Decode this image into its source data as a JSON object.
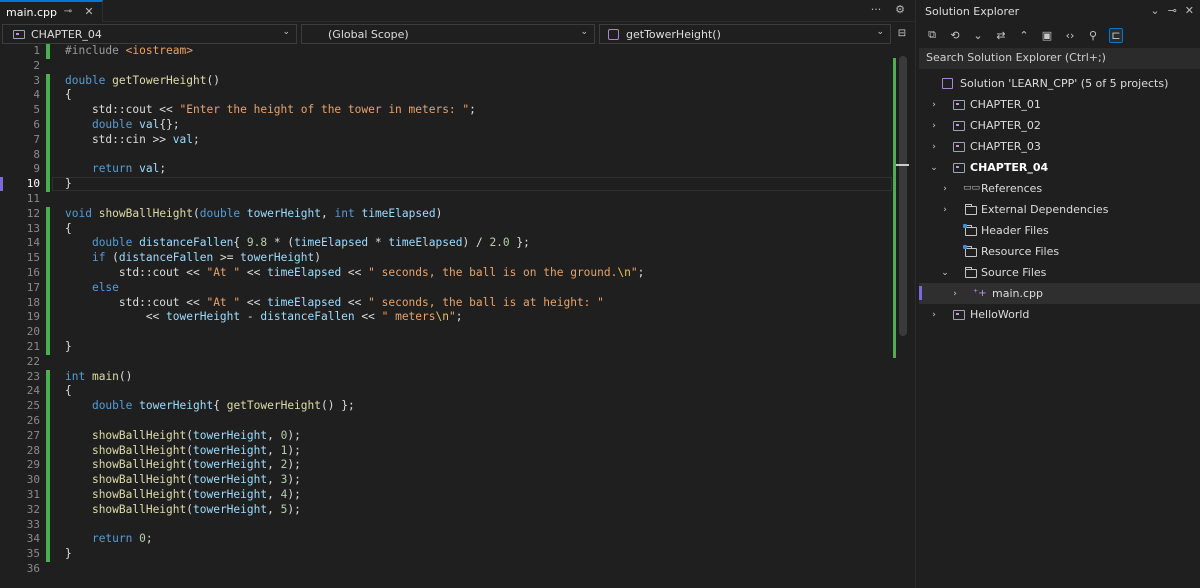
{
  "editor": {
    "tab": {
      "label": "main.cpp"
    },
    "tab_tools": {
      "overflow": "···",
      "settings": "⚙"
    },
    "project_dropdown": "CHAPTER_04",
    "scope_dropdown": "(Global Scope)",
    "member_dropdown": "getTowerHeight()",
    "current_line": 10,
    "line_numbers": [
      "1",
      "2",
      "3",
      "4",
      "5",
      "6",
      "7",
      "8",
      "9",
      "10",
      "11",
      "12",
      "13",
      "14",
      "15",
      "16",
      "17",
      "18",
      "19",
      "20",
      "21",
      "22",
      "23",
      "24",
      "25",
      "26",
      "27",
      "28",
      "29",
      "30",
      "31",
      "32",
      "33",
      "34",
      "35",
      "36"
    ],
    "code_lines": [
      "#include <iostream>",
      "",
      "double getTowerHeight()",
      "{",
      "    std::cout << \"Enter the height of the tower in meters: \";",
      "    double val{};",
      "    std::cin >> val;",
      "",
      "    return val;",
      "}",
      "",
      "void showBallHeight(double towerHeight, int timeElapsed)",
      "{",
      "    double distanceFallen{ 9.8 * (timeElapsed * timeElapsed) / 2.0 };",
      "    if (distanceFallen >= towerHeight)",
      "        std::cout << \"At \" << timeElapsed << \" seconds, the ball is on the ground.\\n\";",
      "    else",
      "        std::cout << \"At \" << timeElapsed << \" seconds, the ball is at height: \"",
      "            << towerHeight - distanceFallen << \" meters\\n\";",
      "",
      "}",
      "",
      "int main()",
      "{",
      "    double towerHeight{ getTowerHeight() };",
      "",
      "    showBallHeight(towerHeight, 0);",
      "    showBallHeight(towerHeight, 1);",
      "    showBallHeight(towerHeight, 2);",
      "    showBallHeight(towerHeight, 3);",
      "    showBallHeight(towerHeight, 4);",
      "    showBallHeight(towerHeight, 5);",
      "",
      "    return 0;",
      "}",
      ""
    ]
  },
  "solution_explorer": {
    "title": "Solution Explorer",
    "search_placeholder": "Search Solution Explorer (Ctrl+;)",
    "solution_label": "Solution 'LEARN_CPP' (5 of 5 projects)",
    "items": [
      {
        "label": "CHAPTER_01"
      },
      {
        "label": "CHAPTER_02"
      },
      {
        "label": "CHAPTER_03"
      },
      {
        "label": "CHAPTER_04"
      },
      {
        "label": "References"
      },
      {
        "label": "External Dependencies"
      },
      {
        "label": "Header Files"
      },
      {
        "label": "Resource Files"
      },
      {
        "label": "Source Files"
      },
      {
        "label": "main.cpp"
      },
      {
        "label": "HelloWorld"
      }
    ]
  }
}
